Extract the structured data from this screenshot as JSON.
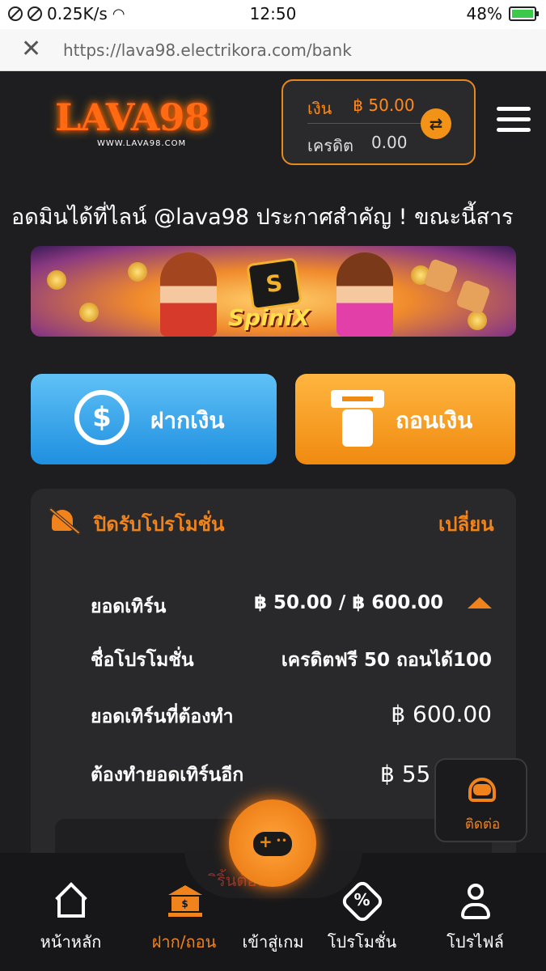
{
  "status_bar": {
    "speed": "0.25K/s",
    "time": "12:50",
    "battery": "48%"
  },
  "browser": {
    "close": "✕",
    "url": "https://lava98.electrikora.com/bank"
  },
  "header": {
    "logo_text": "LAVA98",
    "logo_sub": "WWW.LAVA98.COM",
    "wallet": {
      "money_label": "เงิน",
      "money_value": "฿ 50.00",
      "credit_label": "เครดิต",
      "credit_value": "0.00"
    }
  },
  "marquee": "อดมินได้ที่ไลน์ @lava98     ประกาศสำคัญ ! ขณะนี้สาร",
  "banner": {
    "brand": "SpiniX",
    "logo": "S"
  },
  "actions": {
    "deposit": "ฝากเงิน",
    "withdraw": "ถอนเงิน",
    "deposit_icon": "$"
  },
  "promo": {
    "title": "ปิดรับโปรโมชั่น",
    "change": "เปลี่ยน",
    "turnover_label": "ยอดเทิร์น",
    "turnover_value": "฿ 50.00 / ฿ 600.00",
    "name_label": "ชื่อโปรโมชั่น",
    "name_value": "เครดิตฟรี 50 ถอนได้100",
    "required_label": "ยอดเทิร์นที่ต้องทำ",
    "required_value": "฿ 600.00",
    "remaining_label": "ต้องทำยอดเทิร์นอีก",
    "remaining_value": "฿ 55"
  },
  "contact": {
    "label": "ติดต่อ"
  },
  "hint": "ิริ้นต้องได้ \"",
  "nav": {
    "home": "หน้าหลัก",
    "bank": "ฝาก/ถอน",
    "games": "เข้าสู่เกม",
    "promotions": "โปรโมชั่น",
    "profile": "โปรไฟล์",
    "bank_icon_symbol": "$",
    "promo_icon_symbol": "%"
  }
}
